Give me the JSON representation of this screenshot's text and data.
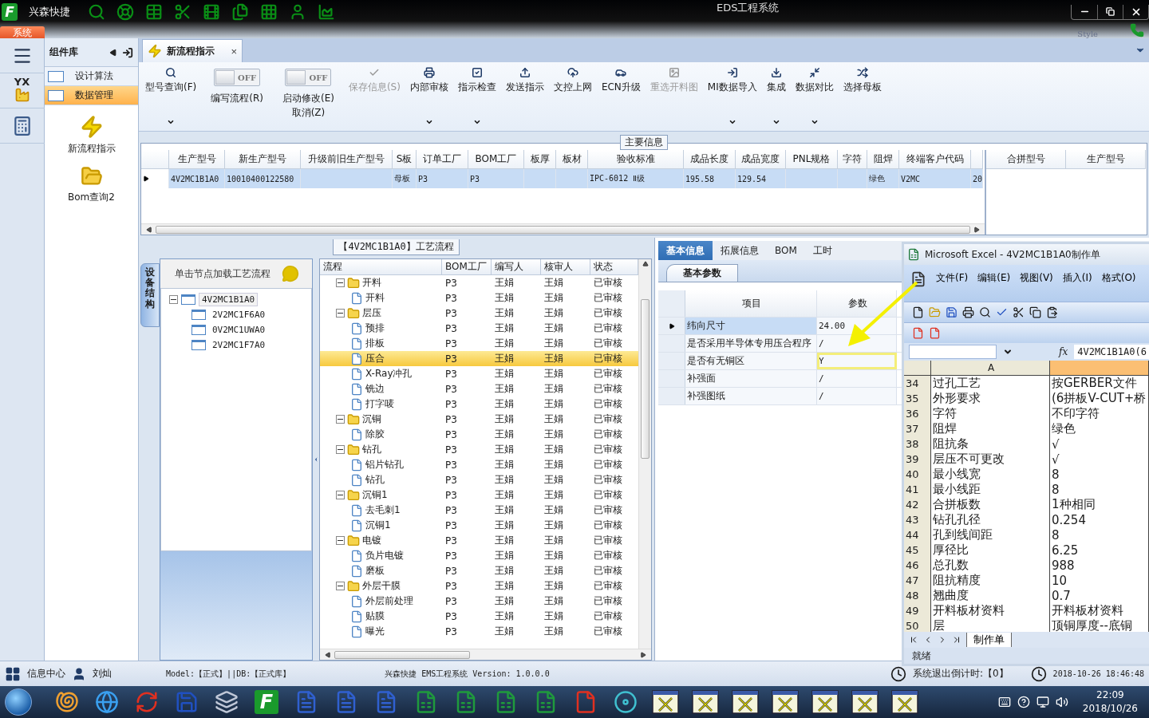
{
  "app": {
    "logo": "F",
    "name": "兴森快捷",
    "title": "EDS工程系统",
    "style_label": "Style",
    "menu_tab": "系统"
  },
  "icon_rail": {
    "logo_text": "YX"
  },
  "sidebar": {
    "title": "组件库",
    "items": [
      {
        "label": "设计算法",
        "selected": false
      },
      {
        "label": "数据管理",
        "selected": true
      }
    ],
    "launchers": [
      {
        "label": "新流程指示"
      },
      {
        "label": "Bom查询2"
      }
    ]
  },
  "doc_tab": {
    "label": "新流程指示",
    "close": "×"
  },
  "ribbon": [
    {
      "kind": "button",
      "label": "型号查询(F)",
      "disabled": false,
      "dropdown": true
    },
    {
      "kind": "toggle",
      "label": "编写流程(R)",
      "switch_text": "OFF",
      "on": false
    },
    {
      "kind": "toggle",
      "label": "启动修改(E)",
      "label2": "取消(Z)",
      "switch_text": "OFF",
      "on": false
    },
    {
      "kind": "button",
      "label": "保存信息(S)",
      "disabled": true,
      "dropdown": false
    },
    {
      "kind": "button",
      "label": "内部审核",
      "disabled": false,
      "dropdown": true
    },
    {
      "kind": "button",
      "label": "指示检查",
      "disabled": false,
      "dropdown": true
    },
    {
      "kind": "button",
      "label": "发送指示",
      "disabled": false,
      "dropdown": false
    },
    {
      "kind": "button",
      "label": "文控上网",
      "disabled": false,
      "dropdown": false
    },
    {
      "kind": "button",
      "label": "ECN升级",
      "disabled": false,
      "dropdown": false
    },
    {
      "kind": "button",
      "label": "重选开料图",
      "disabled": true,
      "dropdown": false
    },
    {
      "kind": "button",
      "label": "MI数据导入",
      "disabled": false,
      "dropdown": true
    },
    {
      "kind": "button",
      "label": "集成",
      "disabled": false,
      "dropdown": true
    },
    {
      "kind": "button",
      "label": "数据对比",
      "disabled": false,
      "dropdown": true
    },
    {
      "kind": "button",
      "label": "选择母板",
      "disabled": false,
      "dropdown": false
    }
  ],
  "main_info": {
    "title": "主要信息",
    "columns": [
      "生产型号",
      "新生产型号",
      "升级前旧生产型号",
      "S板",
      "订单工厂",
      "BOM工厂",
      "板厚",
      "板材",
      "验收标准",
      "成品长度",
      "成品宽度",
      "PNL规格",
      "字符",
      "阻焊",
      "终端客户代码"
    ],
    "rows": [
      {
        "selected": true,
        "cells": [
          "4V2MC1B1A0",
          "10010400122580",
          null,
          "母板",
          "P3",
          "P3",
          null,
          null,
          "IPC-6012 Ⅱ级",
          "195.58",
          "129.54",
          null,
          null,
          "绿色",
          "V2MC",
          "20"
        ]
      }
    ],
    "side_columns": [
      "合拼型号",
      "生产型号"
    ]
  },
  "process": {
    "title": "【4V2MC1B1A0】工艺流程",
    "side_tab": "设备结构",
    "hint": "单击节点加载工艺流程",
    "devices": [
      {
        "label": "4V2MC1B1A0",
        "selected": true,
        "expanded": true,
        "children": [
          {
            "label": "2V2MC1F6A0",
            "selected": false
          },
          {
            "label": "0V2MC1UWA0",
            "selected": false
          },
          {
            "label": "2V2MC1F7A0",
            "selected": false
          }
        ]
      }
    ],
    "columns": [
      "流程",
      "BOM工厂",
      "编写人",
      "核审人",
      "状态"
    ],
    "rows": [
      {
        "name": "开料",
        "bom": "P3",
        "writer": "王娟",
        "reviewer": "王娟",
        "status": "已审核",
        "selected": false,
        "expanded": true,
        "children": [
          {
            "name": "开料",
            "bom": "P3",
            "writer": "王娟",
            "reviewer": "王娟",
            "status": "已审核",
            "selected": false
          }
        ]
      },
      {
        "name": "层压",
        "bom": "P3",
        "writer": "王娟",
        "reviewer": "王娟",
        "status": "已审核",
        "selected": false,
        "expanded": true,
        "children": [
          {
            "name": "预排",
            "bom": "P3",
            "writer": "王娟",
            "reviewer": "王娟",
            "status": "已审核",
            "selected": false
          },
          {
            "name": "排板",
            "bom": "P3",
            "writer": "王娟",
            "reviewer": "王娟",
            "status": "已审核",
            "selected": false
          },
          {
            "name": "压合",
            "bom": "P3",
            "writer": "王娟",
            "reviewer": "王娟",
            "status": "已审核",
            "selected": true
          },
          {
            "name": "X-Ray冲孔",
            "bom": "P3",
            "writer": "王娟",
            "reviewer": "王娟",
            "status": "已审核",
            "selected": false
          },
          {
            "name": "铣边",
            "bom": "P3",
            "writer": "王娟",
            "reviewer": "王娟",
            "status": "已审核",
            "selected": false
          },
          {
            "name": "打字唛",
            "bom": "P3",
            "writer": "王娟",
            "reviewer": "王娟",
            "status": "已审核",
            "selected": false
          }
        ]
      },
      {
        "name": "沉铜",
        "bom": "P3",
        "writer": "王娟",
        "reviewer": "王娟",
        "status": "已审核",
        "selected": false,
        "expanded": true,
        "children": [
          {
            "name": "除胶",
            "bom": "P3",
            "writer": "王娟",
            "reviewer": "王娟",
            "status": "已审核",
            "selected": false
          }
        ]
      },
      {
        "name": "钻孔",
        "bom": "P3",
        "writer": "王娟",
        "reviewer": "王娟",
        "status": "已审核",
        "selected": false,
        "expanded": true,
        "children": [
          {
            "name": "铝片钻孔",
            "bom": "P3",
            "writer": "王娟",
            "reviewer": "王娟",
            "status": "已审核",
            "selected": false
          },
          {
            "name": "钻孔",
            "bom": "P3",
            "writer": "王娟",
            "reviewer": "王娟",
            "status": "已审核",
            "selected": false
          }
        ]
      },
      {
        "name": "沉铜1",
        "bom": "P3",
        "writer": "王娟",
        "reviewer": "王娟",
        "status": "已审核",
        "selected": false,
        "expanded": true,
        "children": [
          {
            "name": "去毛刺1",
            "bom": "P3",
            "writer": "王娟",
            "reviewer": "王娟",
            "status": "已审核",
            "selected": false
          },
          {
            "name": "沉铜1",
            "bom": "P3",
            "writer": "王娟",
            "reviewer": "王娟",
            "status": "已审核",
            "selected": false
          }
        ]
      },
      {
        "name": "电镀",
        "bom": "P3",
        "writer": "王娟",
        "reviewer": "王娟",
        "status": "已审核",
        "selected": false,
        "expanded": true,
        "children": [
          {
            "name": "负片电镀",
            "bom": "P3",
            "writer": "王娟",
            "reviewer": "王娟",
            "status": "已审核",
            "selected": false
          },
          {
            "name": "磨板",
            "bom": "P3",
            "writer": "王娟",
            "reviewer": "王娟",
            "status": "已审核",
            "selected": false
          }
        ]
      },
      {
        "name": "外层干膜",
        "bom": "P3",
        "writer": "王娟",
        "reviewer": "王娟",
        "status": "已审核",
        "selected": false,
        "expanded": true,
        "children": [
          {
            "name": "外层前处理",
            "bom": "P3",
            "writer": "王娟",
            "reviewer": "王娟",
            "status": "已审核",
            "selected": false
          },
          {
            "name": "贴膜",
            "bom": "P3",
            "writer": "王娟",
            "reviewer": "王娟",
            "status": "已审核",
            "selected": false
          },
          {
            "name": "曝光",
            "bom": "P3",
            "writer": "王娟",
            "reviewer": "王娟",
            "status": "已审核",
            "selected": false
          }
        ]
      }
    ]
  },
  "params": {
    "tabs": [
      {
        "label": "基本信息",
        "selected": true
      },
      {
        "label": "拓展信息",
        "selected": false
      },
      {
        "label": "BOM",
        "selected": false
      },
      {
        "label": "工时",
        "selected": false
      }
    ],
    "subtab": "基本参数",
    "columns": [
      "项目",
      "参数"
    ],
    "rows": [
      {
        "name": "纬向尺寸",
        "value": "24.00",
        "selected": true,
        "highlighted": false
      },
      {
        "name": "是否采用半导体专用压合程序",
        "value": "/",
        "selected": false,
        "highlighted": false
      },
      {
        "name": "是否有无铜区",
        "value": "Y",
        "selected": false,
        "highlighted": true
      },
      {
        "name": "补强面",
        "value": "/",
        "selected": false,
        "highlighted": false
      },
      {
        "name": "补强图纸",
        "value": "/",
        "selected": false,
        "highlighted": false
      }
    ]
  },
  "excel": {
    "title": "Microsoft Excel - 4V2MC1B1A0制作单",
    "menus": [
      "文件(F)",
      "编辑(E)",
      "视图(V)",
      "插入(I)",
      "格式(O)"
    ],
    "formula_label": "fx",
    "formula": "4V2MC1B1A0(6",
    "column_a": "A",
    "rows": [
      {
        "row": "34",
        "a": "过孔工艺",
        "b": "按GERBER文件"
      },
      {
        "row": "35",
        "a": "外形要求",
        "b": "(6拼板V-CUT+桥"
      },
      {
        "row": "36",
        "a": "字符",
        "b": "不印字符"
      },
      {
        "row": "37",
        "a": "阻焊",
        "b": "绿色"
      },
      {
        "row": "38",
        "a": "阻抗条",
        "b": "√"
      },
      {
        "row": "39",
        "a": "层压不可更改",
        "b": "√"
      },
      {
        "row": "40",
        "a": "最小线宽",
        "b": "8"
      },
      {
        "row": "41",
        "a": "最小线距",
        "b": "8"
      },
      {
        "row": "42",
        "a": "合拼板数",
        "b": "1种相同"
      },
      {
        "row": "43",
        "a": "钻孔孔径",
        "b": "0.254"
      },
      {
        "row": "44",
        "a": "孔到线间距",
        "b": "8"
      },
      {
        "row": "45",
        "a": "厚径比",
        "b": "6.25"
      },
      {
        "row": "46",
        "a": "总孔数",
        "b": "988"
      },
      {
        "row": "47",
        "a": "阻抗精度",
        "b": "10"
      },
      {
        "row": "48",
        "a": "翘曲度",
        "b": "0.7"
      },
      {
        "row": "49",
        "a": "开料板材资料",
        "b": "开料板材资料"
      },
      {
        "row": "50",
        "a": "层",
        "b": "顶铜厚度--底铜"
      }
    ],
    "sheet_tab": "制作单",
    "status": "就绪"
  },
  "status_bar": {
    "info": "信息中心",
    "user": "刘灿",
    "env": "Model:【正式】||DB:【正式库】",
    "product": "兴森快捷 EMS工程系统 Version: 1.0.0.0",
    "countdown": "系统退出倒计时:【0】",
    "datetime": "2018-10-26 18:46:48"
  },
  "taskbar": {
    "logo_letter": "F",
    "time": "22:09",
    "date": "2018/10/26"
  }
}
